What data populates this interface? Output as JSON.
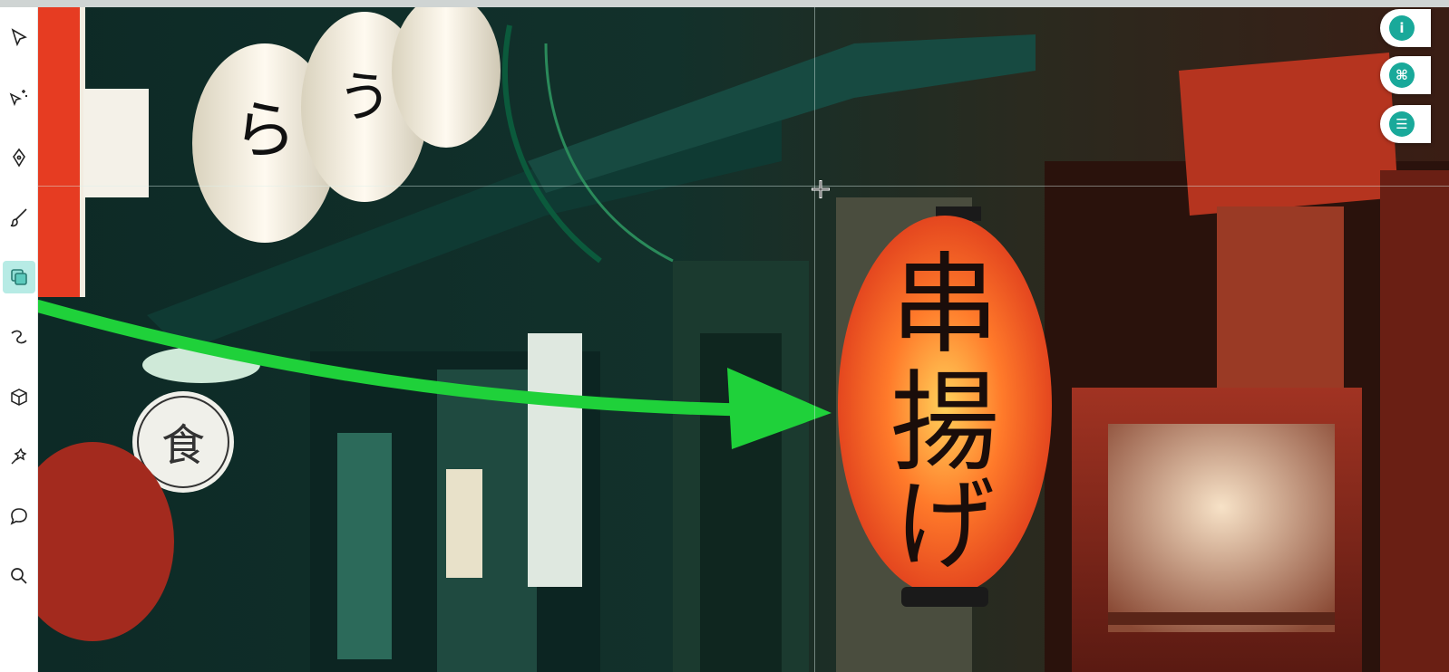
{
  "toolbar": {
    "tools": [
      {
        "name": "select-tool",
        "icon": "cursor-arrow-icon"
      },
      {
        "name": "magic-select-tool",
        "icon": "sparkle-cursor-icon"
      },
      {
        "name": "pen-tool",
        "icon": "pen-nib-icon"
      },
      {
        "name": "brush-tool",
        "icon": "brush-icon"
      },
      {
        "name": "layers-tool",
        "icon": "layers-icon",
        "active": true
      },
      {
        "name": "curve-tool",
        "icon": "curve-icon"
      },
      {
        "name": "3d-tool",
        "icon": "cube-icon"
      },
      {
        "name": "pin-tool",
        "icon": "pin-star-icon"
      },
      {
        "name": "comment-tool",
        "icon": "speech-bubble-icon"
      },
      {
        "name": "zoom-tool",
        "icon": "magnifier-icon"
      }
    ],
    "active_color": "#b7ebe5"
  },
  "right_panel": {
    "buttons": [
      {
        "name": "info-button",
        "icon": "info-icon",
        "glyph": "i"
      },
      {
        "name": "shortcuts-button",
        "icon": "command-icon",
        "glyph": "⌘"
      },
      {
        "name": "settings-button",
        "icon": "sliders-icon",
        "glyph": "☰"
      }
    ],
    "accent": "#19a99a"
  },
  "canvas": {
    "annotation_arrow_color": "#1fd13a",
    "image_content": "night alley with paper lanterns"
  }
}
